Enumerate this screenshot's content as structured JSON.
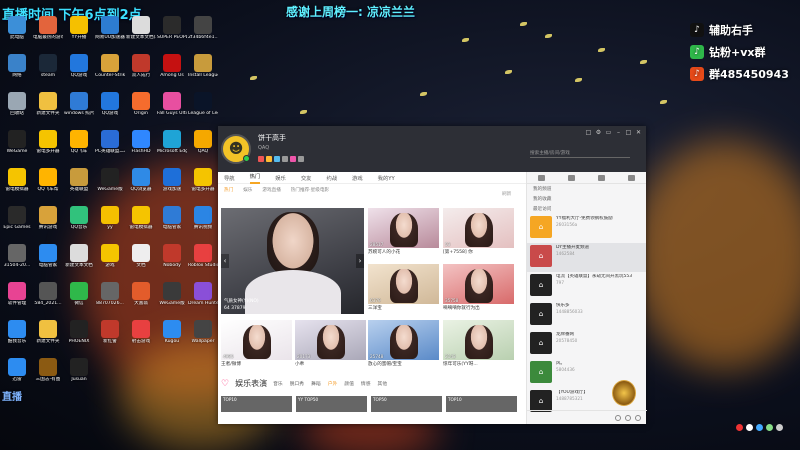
{
  "overlay": {
    "banner_left": "直播时间  下午6点到2点",
    "banner_mid": "感谢上周榜一: 凉凉兰兰",
    "side_lines": [
      {
        "icon": "tiktok-icon",
        "label": "辅助右手",
        "color": "#111111"
      },
      {
        "icon": "wechat-icon",
        "label": "钻粉+vx群",
        "color": "#2fb84a"
      },
      {
        "icon": "qq-icon",
        "label": "群485450943",
        "color": "#e64a19"
      }
    ],
    "watermark": "直播"
  },
  "desktop_icons": [
    {
      "label": "此电脑",
      "color": "#3c8fd8"
    },
    {
      "label": "电脑最热的游戏",
      "color": "#e3643c"
    },
    {
      "label": "YY开播",
      "color": "#f5c000"
    },
    {
      "label": "网易UU加速器",
      "color": "#2d7cd1"
    },
    {
      "label": "新建文本文档(2)",
      "color": "#dcdcdc"
    },
    {
      "label": "SUPER PEOPLE CBT",
      "color": "#2b2b2b"
    },
    {
      "label": "2f34b6f4e1...",
      "color": "#444444"
    },
    {
      "label": "网络",
      "color": "#3a82c9"
    },
    {
      "label": "steam",
      "color": "#1b2838"
    },
    {
      "label": "QQ游戏",
      "color": "#2277dd"
    },
    {
      "label": "Counter-Strike Global Off...",
      "color": "#d8a23a"
    },
    {
      "label": "双人成行",
      "color": "#c0392b"
    },
    {
      "label": "Among Us",
      "color": "#c51111"
    },
    {
      "label": "Install League o...",
      "color": "#c89b3c"
    },
    {
      "label": "回收站",
      "color": "#9aa7b3"
    },
    {
      "label": "新建文件夹",
      "color": "#f0c040"
    },
    {
      "label": "windows 照片查看器",
      "color": "#2f7bd6"
    },
    {
      "label": "QQ游戏",
      "color": "#2277dd"
    },
    {
      "label": "Origin",
      "color": "#f56c2d"
    },
    {
      "label": "Fall Guys Ultimate",
      "color": "#e84fa0"
    },
    {
      "label": "League of Legends",
      "color": "#0a1428"
    },
    {
      "label": "WeGame",
      "color": "#222222"
    },
    {
      "label": "雷电多开器",
      "color": "#f5c400"
    },
    {
      "label": "QQ飞车",
      "color": "#ffb400"
    },
    {
      "label": "PC英雄联盟二次元",
      "color": "#2a6cd6"
    },
    {
      "label": "FlashHD",
      "color": "#2f87ff"
    },
    {
      "label": "Microsoft Edge",
      "color": "#1fa4d6"
    },
    {
      "label": "QAQ",
      "color": "#f5a800"
    },
    {
      "label": "雷电模拟器",
      "color": "#f5c400"
    },
    {
      "label": "QQ飞车帮",
      "color": "#ffb400"
    },
    {
      "label": "英雄联盟",
      "color": "#c89b3c"
    },
    {
      "label": "WeGame版",
      "color": "#222222"
    },
    {
      "label": "QQ浏览器",
      "color": "#2f8ae6"
    },
    {
      "label": "游戏加速",
      "color": "#1e6fd9"
    },
    {
      "label": "雷电多开器",
      "color": "#f5c400"
    },
    {
      "label": "Epic Games",
      "color": "#2a2a2a"
    },
    {
      "label": "腾讯游戏",
      "color": "#d8a23a"
    },
    {
      "label": "QQ音乐",
      "color": "#31c27c"
    },
    {
      "label": "yy",
      "color": "#f5c000"
    },
    {
      "label": "雷电模拟器",
      "color": "#f5c400"
    },
    {
      "label": "电脑管家",
      "color": "#2f7bd6"
    },
    {
      "label": "腾讯视频",
      "color": "#2b85e4"
    },
    {
      "label": "31504-20...",
      "color": "#666666"
    },
    {
      "label": "电脑管家",
      "color": "#2d8cf0"
    },
    {
      "label": "新建文本文档",
      "color": "#dcdcdc"
    },
    {
      "label": "游戏",
      "color": "#f5c400"
    },
    {
      "label": "文档",
      "color": "#eeeeee"
    },
    {
      "label": "Nobody",
      "color": "#c0392b"
    },
    {
      "label": "Roblox Studio",
      "color": "#e84040"
    },
    {
      "label": "软件管理",
      "color": "#e84393"
    },
    {
      "label": "584_2021...",
      "color": "#555555"
    },
    {
      "label": "微信",
      "color": "#2fb84a"
    },
    {
      "label": "88707026...",
      "color": "#666666"
    },
    {
      "label": "大富翁",
      "color": "#e35c2b"
    },
    {
      "label": "WeGame版",
      "color": "#3a3a3a"
    },
    {
      "label": "Dream Hunter",
      "color": "#8a4fd8"
    },
    {
      "label": "酷我音乐",
      "color": "#2d8cf0"
    },
    {
      "label": "新建文件夹",
      "color": "#f0c040"
    },
    {
      "label": "PHOENIX",
      "color": "#222222"
    },
    {
      "label": "新红警",
      "color": "#c0392b"
    },
    {
      "label": "射击游戏",
      "color": "#e84040"
    },
    {
      "label": "Kugou",
      "color": "#2d8cf0"
    },
    {
      "label": "Wallpaper",
      "color": "#444444"
    },
    {
      "label": "迅雷",
      "color": "#2d8cf0"
    },
    {
      "label": "三国志-有图",
      "color": "#8b5a12"
    },
    {
      "label": "Jusuan",
      "color": "#222222"
    }
  ],
  "window": {
    "username": "饼干高手",
    "subtitle": "QAQ",
    "search_placeholder": "搜索主播/房间/游戏",
    "controls": [
      "□",
      "⚙",
      "▭",
      "–",
      "□",
      "✕"
    ],
    "topnav": [
      "导航",
      "热门",
      "娱乐",
      "交友",
      "约战",
      "游戏",
      "我的YY"
    ],
    "topnav_active": 1,
    "subnav": [
      "热门",
      "娱乐",
      "游戏直播",
      "热门推荐·星级电影"
    ],
    "subnav_active": 0,
    "refresh_label": "刷新",
    "hero": {
      "caption": "气质女神(Y)(NO)",
      "count": "64",
      "count2": "37879"
    },
    "cards": [
      {
        "count": "28517",
        "title": "苏婉可人的小花",
        "c1": "#b88a9a",
        "c2": "#efe1ea"
      },
      {
        "count": "53",
        "title": "[第+7558] 你",
        "c1": "#e4c0c0",
        "c2": "#f4ecec"
      },
      {
        "count": "6379",
        "title": "三洋宝",
        "c1": "#d0b898",
        "c2": "#f2e3ce"
      },
      {
        "count": "35758",
        "title": "嘀嘀嘀你就行为出",
        "c1": "#d86a6a",
        "c2": "#f3c3c3"
      },
      {
        "count": "4985",
        "title": "王者/微博",
        "c1": "#eae4ea",
        "c2": "#ffffff"
      },
      {
        "count": "20173",
        "title": "小乖",
        "c1": "#aaa8b8",
        "c2": "#e6e2ee"
      },
      {
        "count": "25748",
        "title": "放心的蜜帽/宝宝",
        "c1": "#5a8ac8",
        "c2": "#b8d0ee"
      },
      {
        "count": "2143",
        "title": "惊年可乐(YY呀...",
        "c1": "#b9d0b0",
        "c2": "#eaf2e4"
      }
    ],
    "section": {
      "title": "娱乐表演",
      "tabs": [
        "音乐",
        "脱口秀",
        "舞蹈",
        "户外",
        "颜值",
        "情感",
        "其他"
      ],
      "hot_index": 3
    },
    "strip": [
      "TOP10",
      "YY TOP50",
      "TOP50",
      "TOP10"
    ],
    "sidebar": {
      "sections": [
        "我的频道",
        "我的收藏",
        "最近访问"
      ],
      "items": [
        {
          "title": "YY福利大厅-免费领钢权鼓励",
          "meta": "2603156a",
          "color": "#f5a623",
          "icon": "gift-icon"
        },
        {
          "title": "DY主播开麦频道",
          "meta": "1462584",
          "color": "#c94a4a",
          "icon": "mic-icon",
          "selected": true
        },
        {
          "title": "电流【英雄联盟】永劫无间开黑玩553",
          "meta": "797",
          "color": "#222222",
          "icon": "house-icon"
        },
        {
          "title": "快乐多",
          "meta": "1448856033",
          "color": "#222222",
          "icon": "house-icon"
        },
        {
          "title": "龙牌番网",
          "meta": "20578450",
          "color": "#222222",
          "icon": "house-icon"
        },
        {
          "title": "风。",
          "meta": "5804436",
          "color": "#3c8a3c",
          "icon": "leaf-icon"
        },
        {
          "title": "【YOU游戏厅】",
          "meta": "1488785321",
          "color": "#222222",
          "icon": "house-icon"
        }
      ]
    }
  }
}
